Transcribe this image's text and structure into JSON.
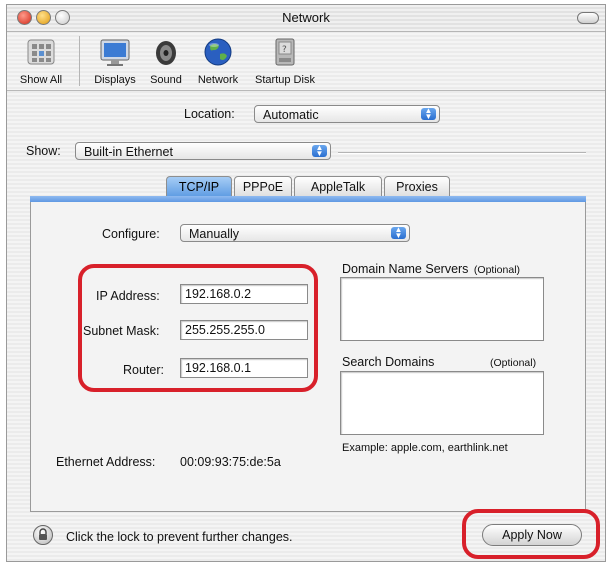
{
  "window": {
    "title": "Network"
  },
  "toolbar": {
    "items": [
      {
        "label": "Show All",
        "icon": "apple-grid-icon"
      },
      {
        "label": "Displays",
        "icon": "display-icon"
      },
      {
        "label": "Sound",
        "icon": "speaker-icon"
      },
      {
        "label": "Network",
        "icon": "globe-icon"
      },
      {
        "label": "Startup Disk",
        "icon": "disk-icon"
      }
    ]
  },
  "location": {
    "label": "Location:",
    "value": "Automatic"
  },
  "show": {
    "label": "Show:",
    "value": "Built-in Ethernet"
  },
  "tabs": [
    {
      "label": "TCP/IP",
      "active": true
    },
    {
      "label": "PPPoE",
      "active": false
    },
    {
      "label": "AppleTalk",
      "active": false
    },
    {
      "label": "Proxies",
      "active": false
    }
  ],
  "tcpip": {
    "configure_label": "Configure:",
    "configure_value": "Manually",
    "ip_label": "IP Address:",
    "ip_value": "192.168.0.2",
    "subnet_label": "Subnet Mask:",
    "subnet_value": "255.255.255.0",
    "router_label": "Router:",
    "router_value": "192.168.0.1",
    "dns_label": "Domain Name Servers",
    "dns_optional": "(Optional)",
    "search_label": "Search Domains",
    "search_optional": "(Optional)",
    "example": "Example: apple.com, earthlink.net",
    "ethernet_label": "Ethernet Address:",
    "ethernet_value": "00:09:93:75:de:5a"
  },
  "footer": {
    "lock_text": "Click the lock to prevent further changes.",
    "apply_label": "Apply Now"
  },
  "colors": {
    "highlight": "#d8202a",
    "aqua_blue": "#2a6fd0"
  }
}
